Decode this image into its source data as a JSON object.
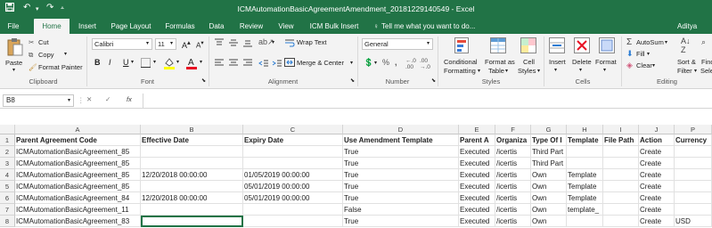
{
  "window": {
    "title": "ICMAutomationBasicAgreementAmendment_20181229140549 - Excel",
    "user": "Aditya"
  },
  "tabs": [
    "File",
    "Home",
    "Insert",
    "Page Layout",
    "Formulas",
    "Data",
    "Review",
    "View",
    "ICM Bulk Insert"
  ],
  "tell_me": "Tell me what you want to do...",
  "ribbon": {
    "clipboard": {
      "paste": "Paste",
      "cut": "Cut",
      "copy": "Copy",
      "format_painter": "Format Painter",
      "label": "Clipboard"
    },
    "font": {
      "name": "Calibri",
      "size": "11",
      "label": "Font",
      "bold": "B",
      "italic": "I",
      "underline": "U"
    },
    "alignment": {
      "wrap": "Wrap Text",
      "merge": "Merge & Center",
      "label": "Alignment"
    },
    "number": {
      "format": "General",
      "label": "Number"
    },
    "styles": {
      "conditional": "Conditional",
      "conditional2": "Formatting",
      "format_table": "Format as",
      "format_table2": "Table",
      "cell_styles": "Cell",
      "cell_styles2": "Styles",
      "label": "Styles"
    },
    "cells": {
      "insert": "Insert",
      "delete": "Delete",
      "format": "Format",
      "label": "Cells"
    },
    "editing": {
      "autosum": "AutoSum",
      "fill": "Fill",
      "clear": "Clear",
      "sort": "Sort &",
      "sort2": "Filter",
      "find": "Find &",
      "find2": "Sele",
      "label": "Editing"
    }
  },
  "formula_bar": {
    "name_box": "B8",
    "fx": "fx",
    "cancel": "✕",
    "enter": "✓"
  },
  "columns": [
    "A",
    "B",
    "C",
    "D",
    "E",
    "F",
    "G",
    "H",
    "I",
    "J",
    "P"
  ],
  "rows": [
    {
      "n": "1",
      "cells": [
        "Parent Agreement Code",
        "Effective Date",
        "Expiry Date",
        "Use Amendment Template",
        "Parent A",
        "Organiza",
        "Type Of I",
        "Template",
        "File Path",
        "Action",
        "Currency"
      ]
    },
    {
      "n": "2",
      "cells": [
        "ICMAutomationBasicAgreement_85",
        "",
        "",
        "True",
        "Executed",
        "/icertis",
        "Third Part",
        "",
        "",
        "Create",
        ""
      ]
    },
    {
      "n": "3",
      "cells": [
        "ICMAutomationBasicAgreement_85",
        "",
        "",
        "True",
        "Executed",
        "/icertis",
        "Third Part",
        "",
        "",
        "Create",
        ""
      ]
    },
    {
      "n": "4",
      "cells": [
        "ICMAutomationBasicAgreement_85",
        "12/20/2018 00:00:00",
        "01/05/2019 00:00:00",
        "True",
        "Executed",
        "/icertis",
        "Own",
        "Template",
        "",
        "Create",
        ""
      ]
    },
    {
      "n": "5",
      "cells": [
        "ICMAutomationBasicAgreement_85",
        "",
        "05/01/2019 00:00:00",
        "True",
        "Executed",
        "/icertis",
        "Own",
        "Template",
        "",
        "Create",
        ""
      ]
    },
    {
      "n": "6",
      "cells": [
        "ICMAutomationBasicAgreement_84",
        "12/20/2018 00:00:00",
        "05/01/2019 00:00:00",
        "True",
        "Executed",
        "/icertis",
        "Own",
        "Template",
        "",
        "Create",
        ""
      ]
    },
    {
      "n": "7",
      "cells": [
        "ICMAutomationBasicAgreement_11",
        "",
        "",
        "False",
        "Executed",
        "/icertis",
        "Own",
        "template_",
        "",
        "Create",
        ""
      ]
    },
    {
      "n": "8",
      "cells": [
        "ICMAutomationBasicAgreement_83",
        "",
        "",
        "True",
        "Executed",
        "/icertis",
        "Own",
        "",
        "",
        "Create",
        "USD"
      ]
    }
  ]
}
